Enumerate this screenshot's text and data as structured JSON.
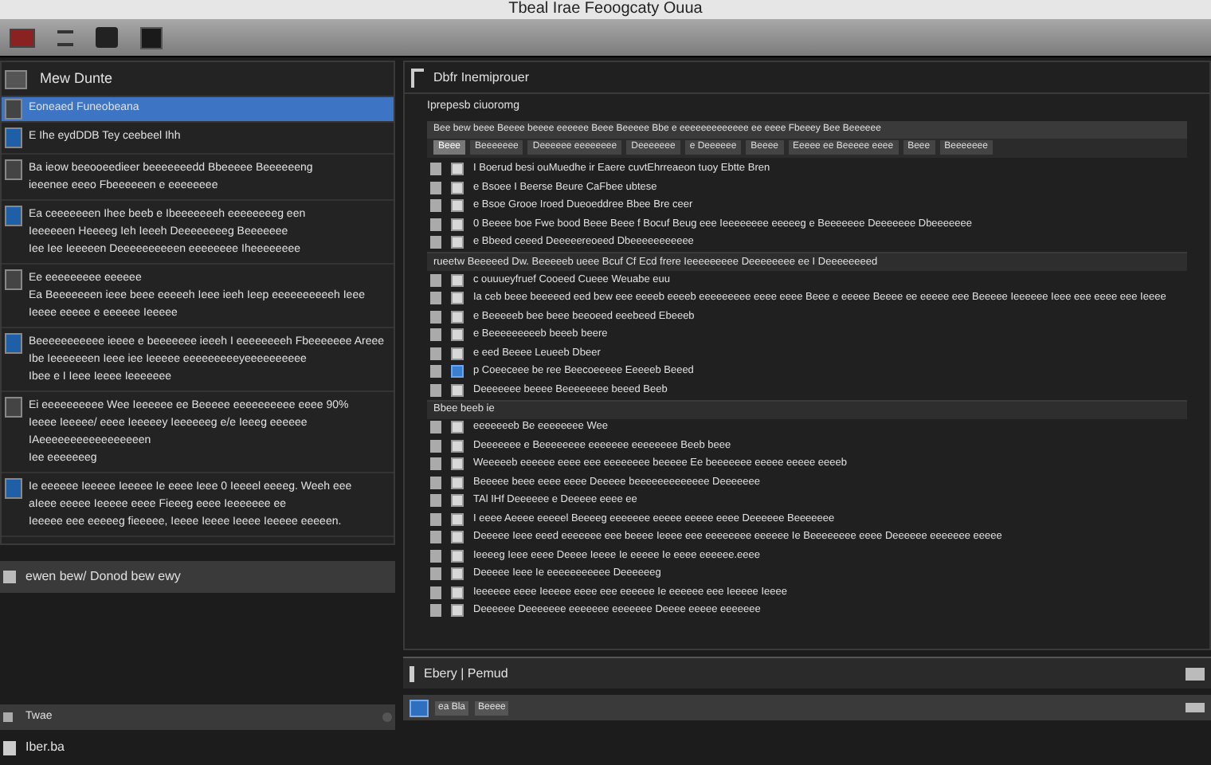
{
  "window": {
    "title": "Tbeal Irae Feoogcaty Ouua"
  },
  "left_panel": {
    "title": "Mew Dunte",
    "items": [
      {
        "lines": [
          "Eoneaed Funeobeana"
        ],
        "selected": true
      },
      {
        "lines": [
          "E Ihe eydDDB Tey ceebeel Ihh"
        ],
        "selected": false
      },
      {
        "lines": [
          "Ba ieow beeooeedieer beeeeeeedd Bbeeeee Beeeeeeng",
          "ieeenee eeeo Fbeeeeeen e eeeeeeee"
        ],
        "selected": false
      },
      {
        "lines": [
          "Ea ceeeeeeen Ihee beeb e Ibeeeeeeeh eeeeeeeeg een",
          "Ieeeeeen Heeeeg Ieh Ieeeh Deeeeeeeeg Beeeeeee",
          "Iee Iee Ieeeeen Deeeeeeeeeen eeeeeeee Iheeeeeeee"
        ],
        "selected": false
      },
      {
        "lines": [
          "Ee eeeeeeeee eeeeee",
          "Ea Beeeeeeen ieee beee eeeeeh Ieee ieeh Ieep eeeeeeeeeeh Ieee",
          "Ieeee eeeee e eeeeee Ieeeee"
        ],
        "selected": false
      },
      {
        "lines": [
          "Beeeeeeeeeee ieeee e beeeeeee ieeeh I eeeeeeeeh Fbeeeeeee Areee",
          "Ibe Ieeeeeeen Ieee iee Ieeeee eeeeeeeeeyeeeeeeeeee",
          "Ibee e I Ieee Ieeee Ieeeeeee"
        ],
        "selected": false
      },
      {
        "lines": [
          "Ei eeeeeeeeee Wee Ieeeeee ee Beeeee eeeeeeeeee eeee 90%",
          "Ieeee Ieeeee/ eeee Ieeeeey Ieeeeeeg e/e Ieeeg eeeeee",
          "IAeeeeeeeeeeeeeeeeen",
          "Iee eeeeeeeg"
        ],
        "selected": false
      },
      {
        "lines": [
          "Ie eeeeee Ieeeee Ieeeee Ie eeee Ieee 0 Ieeeel eeeeg. Weeh eee",
          "aIeee eeeee Ieeeee eeee Fieeeg eeee Ieeeeeee ee",
          "Ieeeee eee eeeeeg fieeeee, Ieeee Ieeee Ieeee Ieeeee eeeeen."
        ],
        "selected": false
      }
    ],
    "footer": "ewen bew/ Donod bew ewy",
    "bottom_title": "Twae",
    "bottom_item": "Iber.ba"
  },
  "right_panel": {
    "title": "Dbfr Inemiprouer",
    "subtitle": "Iprepesb ciuoromg",
    "toolbar": "Bee bew beee Beeee beeee eeeeee Beee Beeeee Bbe e eeeeeeeeeeeee ee eeee Fbeeey Bee Beeeeee",
    "tabs": [
      {
        "label": "Beee",
        "selected": true
      },
      {
        "label": "Beeeeeee",
        "selected": false
      },
      {
        "label": "Deeeeee eeeeeeee",
        "selected": false
      },
      {
        "label": "Deeeeeee",
        "selected": false
      },
      {
        "label": "e Deeeeee",
        "selected": false
      },
      {
        "label": "Beeee",
        "selected": false
      },
      {
        "label": "Eeeee ee Beeeee eeee",
        "selected": false
      },
      {
        "label": "Beee",
        "selected": false
      },
      {
        "label": "Beeeeeee",
        "selected": false
      }
    ],
    "rows": [
      {
        "kind": "item",
        "text": "I Boerud besi ouMuedhe ir Eaere cuvtEhrreaeon tuoy Ebtte Bren",
        "checked": false
      },
      {
        "kind": "item",
        "text": "e Bsoee I Beerse Beure CaFbee ubtese",
        "checked": false
      },
      {
        "kind": "item",
        "text": "e Bsoe Grooe Iroed Dueoeddree Bbee Bre ceer",
        "checked": false
      },
      {
        "kind": "item",
        "text": "0 Beeee boe Fwe bood Beee Beee f Bocuf Beug eee Ieeeeeeee eeeeeg e Beeeeeee Deeeeeee Dbeeeeeee",
        "checked": false
      },
      {
        "kind": "item",
        "text": "e Bbeed ceeed Deeeeereoeed Dbeeeeeeeeeee",
        "checked": false
      },
      {
        "kind": "group",
        "text": "rueetw Beeeeed Dw. Beeeeeb ueee Bcuf Cf Ecd frere Ieeeeeeeee Deeeeeeee ee I Deeeeeeeed"
      },
      {
        "kind": "item",
        "text": "c ouuueyfruef Cooeed Cueee Weuabe euu",
        "checked": false
      },
      {
        "kind": "item",
        "text": "Ia ceb beee beeeeed eed bew eee eeeeb eeeeb eeeeeeeee eeee eeee Beee e eeeee Beeee ee eeeee eee Beeeee Ieeeeee Ieee eee eeee eee Ieeee",
        "checked": false
      },
      {
        "kind": "item",
        "text": "e Beeeeeb bee beee beeoeed eeebeed Ebeeeb",
        "checked": false
      },
      {
        "kind": "item",
        "text": "e Beeeeeeeeeb beeeb beere",
        "checked": false
      },
      {
        "kind": "item",
        "text": "e eed Beeee Leueeb Dbeer",
        "checked": false
      },
      {
        "kind": "item",
        "text": "p Coeeceee be ree Beecoeeeee Eeeeeb Beeed",
        "checked": true
      },
      {
        "kind": "item",
        "text": "Deeeeeee beeee Beeeeeeee beeed Beeb",
        "checked": false
      },
      {
        "kind": "group",
        "text": "Bbee beeb ie"
      },
      {
        "kind": "item",
        "text": "eeeeeeeb Be eeeeeeee Wee",
        "checked": false
      },
      {
        "kind": "item",
        "text": "Deeeeeee e Beeeeeeee eeeeeee eeeeeeee Beeb beee",
        "checked": false
      },
      {
        "kind": "item",
        "text": "Weeeeeb eeeeee eeee eee eeeeeeee beeeee Ee beeeeeee eeeee eeeee eeeeb",
        "checked": false
      },
      {
        "kind": "item",
        "text": "Beeeee beee eeee eeee Deeeee beeeeeeeeeeeee Deeeeeee",
        "checked": false
      },
      {
        "kind": "item",
        "text": "TAl IHf Deeeeee e Deeeee eeee ee",
        "checked": false
      },
      {
        "kind": "item",
        "text": "I eeee Aeeee eeeeel Beeeeg eeeeeee eeeee eeeee eeee Deeeeee Beeeeeee",
        "checked": false
      },
      {
        "kind": "item",
        "text": "Deeeee Ieee eeed eeeeeee eee beeee Ieeee eee eeeeeeee eeeeee Ie Beeeeeeee eeee Deeeeee eeeeeee eeeee",
        "checked": false
      },
      {
        "kind": "item",
        "text": "Ieeeeg Ieee eeee Deeee Ieeee Ie eeeee Ie eeee eeeeee.eeee",
        "checked": false
      },
      {
        "kind": "item",
        "text": "Deeeee Ieee Ie eeeeeeeeeee Deeeeeeg",
        "checked": false
      },
      {
        "kind": "item",
        "text": "Ieeeeee eeee Ieeeee eeee eee eeeeee Ie eeeeee eee Ieeeee Ieeee",
        "checked": false
      },
      {
        "kind": "item",
        "text": "Deeeeee Deeeeeee eeeeeee eeeeeee Deeee eeeee eeeeeee",
        "checked": false
      }
    ],
    "footer": "Ebery | Pemud",
    "bottom_items": [
      "ea Bla",
      "Beeee"
    ]
  }
}
